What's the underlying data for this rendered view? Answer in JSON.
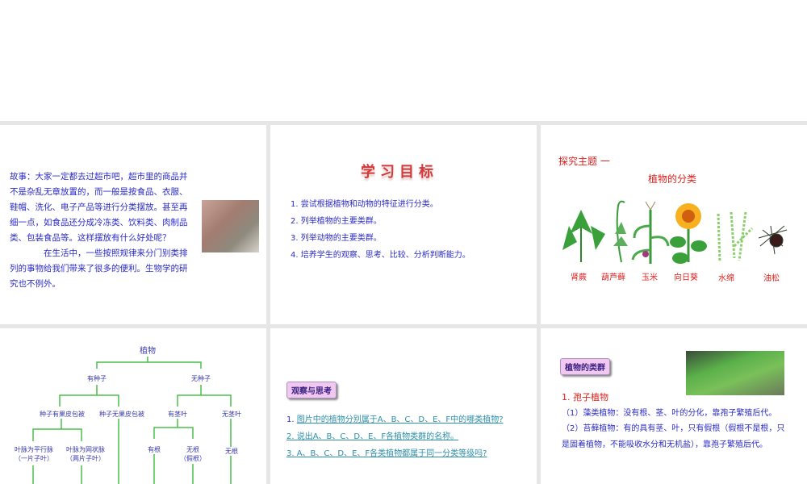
{
  "slide1": {
    "paragraph1": "故事：大家一定都去过超市吧，超市里的商品并不是杂乱无章放置的，而一般是按食品、衣服、鞋帽、洗化、电子产品等进行分类摆放。甚至再细一点，如食品还分成冷冻类、饮料类、肉制品类、包装食品等。这样摆放有什么好处呢？",
    "paragraph2": "在生活中，一些按照规律来分门别类排列的事物给我们带来了很多的便利。生物学的研究也不例外。"
  },
  "slide2": {
    "title": "学习目标",
    "goals": [
      "1. 尝试根据植物和动物的特征进行分类。",
      "2. 列举植物的主要类群。",
      "3. 列举动物的主要类群。",
      "4. 培养学生的观察、思考、比较、分析判断能力。"
    ]
  },
  "slide3": {
    "heading": "探究主题 一",
    "subtitle": "植物的分类",
    "plants": [
      "肾蕨",
      "葫芦藓",
      "玉米",
      "向日葵",
      "水绵",
      "油松"
    ]
  },
  "slide4": {
    "root": "植物",
    "seed": "有种子",
    "noseed": "无种子",
    "fruit": "种子有果皮包被",
    "nofruit": "种子无果皮包被",
    "stem": "有茎叶",
    "nostem": "无茎叶",
    "parallel": "叶脉为平行脉",
    "parallel2": "（一片子叶）",
    "net": "叶脉为网状脉",
    "net2": "（两片子叶）",
    "root1": "有根",
    "noroot": "无根",
    "noroot2": "（假根）",
    "noroot3": "无根"
  },
  "slide5": {
    "tag": "观察与思考",
    "questions": [
      {
        "num": "1. ",
        "text": "图片中的植物分别属于A、B、C、D、E、F中的哪类植物?"
      },
      {
        "num": "",
        "text": "2. 说出A、B、C、D、E、F各植物类群的名称。"
      },
      {
        "num": "",
        "text": "3. A、B、C、D、E、F各类植物都属于同一分类等级吗?"
      }
    ]
  },
  "slide6": {
    "tag": "植物的类群",
    "heading": "1. 孢子植物",
    "p1": "（1）藻类植物：没有根、茎、叶的分化，靠孢子繁殖后代。",
    "p2": "（2）苔藓植物：有的具有茎、叶，只有假根（假根不是根，只是固着植物，不能吸收水分和无机盐），靠孢子繁殖后代。"
  }
}
